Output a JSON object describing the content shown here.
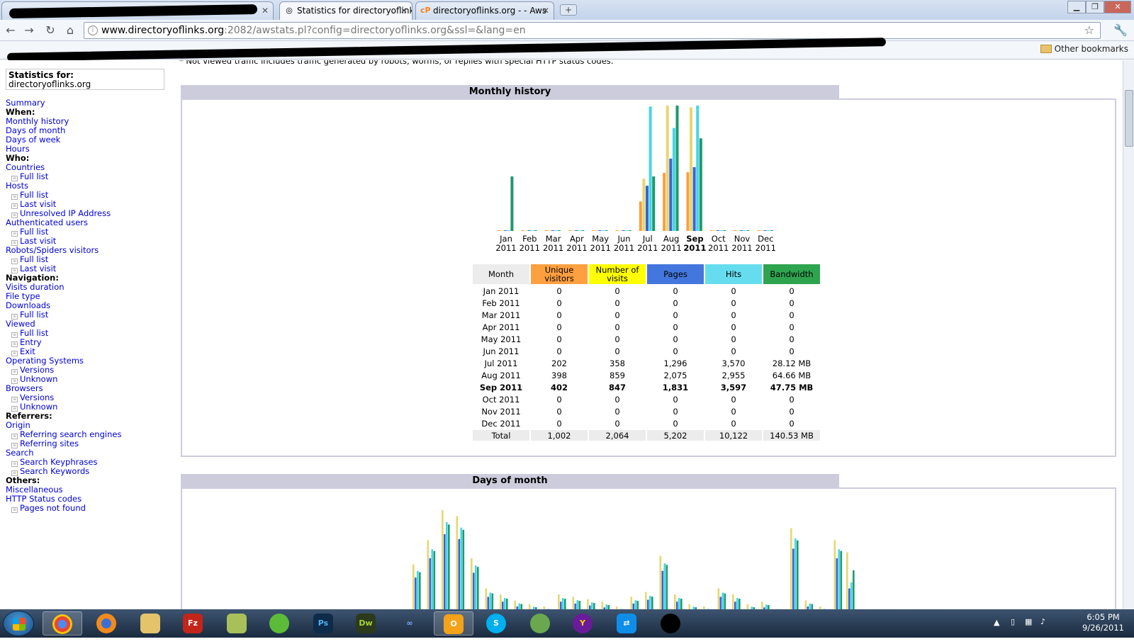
{
  "browser": {
    "tabs": [
      {
        "label": "",
        "redacted": true
      },
      {
        "label": "Statistics for directoryoflink",
        "active": true,
        "icon": "globe-icon"
      },
      {
        "label": "directoryoflinks.org - - Aws",
        "icon": "cpanel-icon"
      }
    ],
    "url_host": "www.directoryoflinks.org",
    "url_rest": ":2082/awstats.pl?config=directoryoflinks.org&ssl=&lang=en",
    "bookmarks_other": "Other bookmarks"
  },
  "page": {
    "note": "* Not viewed traffic includes traffic generated by robots, worms, or replies with special HTTP status codes.",
    "stats_for_label": "Statistics for:",
    "stats_for_site": "directoryoflinks.org",
    "menu": [
      {
        "t": "link",
        "label": "Summary"
      },
      {
        "t": "head",
        "label": "When:"
      },
      {
        "t": "link",
        "label": "Monthly history"
      },
      {
        "t": "link",
        "label": "Days of month"
      },
      {
        "t": "link",
        "label": "Days of week"
      },
      {
        "t": "link",
        "label": "Hours"
      },
      {
        "t": "head",
        "label": "Who:"
      },
      {
        "t": "link",
        "label": "Countries"
      },
      {
        "t": "sub",
        "label": "Full list"
      },
      {
        "t": "link",
        "label": "Hosts"
      },
      {
        "t": "sub",
        "label": "Full list"
      },
      {
        "t": "sub",
        "label": "Last visit"
      },
      {
        "t": "sub",
        "label": "Unresolved IP Address"
      },
      {
        "t": "link",
        "label": "Authenticated users"
      },
      {
        "t": "sub",
        "label": "Full list"
      },
      {
        "t": "sub",
        "label": "Last visit"
      },
      {
        "t": "link",
        "label": "Robots/Spiders visitors"
      },
      {
        "t": "sub",
        "label": "Full list"
      },
      {
        "t": "sub",
        "label": "Last visit"
      },
      {
        "t": "head",
        "label": "Navigation:"
      },
      {
        "t": "link",
        "label": "Visits duration"
      },
      {
        "t": "link",
        "label": "File type"
      },
      {
        "t": "link",
        "label": "Downloads"
      },
      {
        "t": "sub",
        "label": "Full list"
      },
      {
        "t": "link",
        "label": "Viewed"
      },
      {
        "t": "sub",
        "label": "Full list"
      },
      {
        "t": "sub",
        "label": "Entry"
      },
      {
        "t": "sub",
        "label": "Exit"
      },
      {
        "t": "link",
        "label": "Operating Systems"
      },
      {
        "t": "sub",
        "label": "Versions"
      },
      {
        "t": "sub",
        "label": "Unknown"
      },
      {
        "t": "link",
        "label": "Browsers"
      },
      {
        "t": "sub",
        "label": "Versions"
      },
      {
        "t": "sub",
        "label": "Unknown"
      },
      {
        "t": "head",
        "label": "Referrers:"
      },
      {
        "t": "link",
        "label": "Origin"
      },
      {
        "t": "sub",
        "label": "Referring search engines"
      },
      {
        "t": "sub",
        "label": "Referring sites"
      },
      {
        "t": "link",
        "label": "Search"
      },
      {
        "t": "sub",
        "label": "Search Keyphrases"
      },
      {
        "t": "sub",
        "label": "Search Keywords"
      },
      {
        "t": "head",
        "label": "Others:"
      },
      {
        "t": "link",
        "label": "Miscellaneous"
      },
      {
        "t": "link",
        "label": "HTTP Status codes"
      },
      {
        "t": "sub",
        "label": "Pages not found"
      }
    ],
    "monthly_title": "Monthly history",
    "days_title": "Days of month",
    "table": {
      "headers": [
        "Month",
        "Unique visitors",
        "Number of visits",
        "Pages",
        "Hits",
        "Bandwidth"
      ],
      "rows": [
        [
          "Jan 2011",
          "0",
          "0",
          "0",
          "0",
          "0"
        ],
        [
          "Feb 2011",
          "0",
          "0",
          "0",
          "0",
          "0"
        ],
        [
          "Mar 2011",
          "0",
          "0",
          "0",
          "0",
          "0"
        ],
        [
          "Apr 2011",
          "0",
          "0",
          "0",
          "0",
          "0"
        ],
        [
          "May 2011",
          "0",
          "0",
          "0",
          "0",
          "0"
        ],
        [
          "Jun 2011",
          "0",
          "0",
          "0",
          "0",
          "0"
        ],
        [
          "Jul 2011",
          "202",
          "358",
          "1,296",
          "3,570",
          "28.12 MB"
        ],
        [
          "Aug 2011",
          "398",
          "859",
          "2,075",
          "2,955",
          "64.66 MB"
        ],
        [
          "Sep 2011",
          "402",
          "847",
          "1,831",
          "3,597",
          "47.75 MB"
        ],
        [
          "Oct 2011",
          "0",
          "0",
          "0",
          "0",
          "0"
        ],
        [
          "Nov 2011",
          "0",
          "0",
          "0",
          "0",
          "0"
        ],
        [
          "Dec 2011",
          "0",
          "0",
          "0",
          "0",
          "0"
        ]
      ],
      "current_row": 8,
      "total": [
        "Total",
        "1,002",
        "2,064",
        "5,202",
        "10,122",
        "140.53 MB"
      ]
    }
  },
  "chart_data": {
    "type": "bar",
    "categories": [
      "Jan",
      "Feb",
      "Mar",
      "Apr",
      "May",
      "Jun",
      "Jul",
      "Aug",
      "Sep",
      "Oct",
      "Nov",
      "Dec"
    ],
    "category_years": [
      "2011",
      "2011",
      "2011",
      "2011",
      "2011",
      "2011",
      "2011",
      "2011",
      "2011",
      "2011",
      "2011",
      "2011"
    ],
    "highlight_category": "Sep",
    "series": [
      {
        "name": "Unique visitors",
        "color": "#f8a040",
        "values": [
          0,
          0,
          0,
          0,
          0,
          0,
          202,
          398,
          402,
          0,
          0,
          0
        ]
      },
      {
        "name": "Number of visits",
        "color": "#e6d770",
        "values": [
          0,
          0,
          0,
          0,
          0,
          0,
          358,
          859,
          847,
          0,
          0,
          0
        ]
      },
      {
        "name": "Pages",
        "color": "#3a62d6",
        "values": [
          0,
          0,
          0,
          0,
          0,
          0,
          1296,
          2075,
          1831,
          0,
          0,
          0
        ]
      },
      {
        "name": "Hits",
        "color": "#46d6e8",
        "values": [
          0,
          0,
          0,
          0,
          0,
          0,
          3570,
          2955,
          3597,
          0,
          0,
          0
        ]
      },
      {
        "name": "Bandwidth",
        "color": "#1e9a6a",
        "values": [
          28.12,
          0,
          0,
          0,
          0,
          0,
          28.12,
          64.66,
          47.75,
          0,
          0,
          0
        ]
      }
    ],
    "header_colors": {
      "month": "#ececec",
      "unique": "#ffa040",
      "visits": "#ffff00",
      "pages": "#4477dd",
      "hits": "#66ddee",
      "bandwidth": "#2ea44f"
    }
  },
  "taskbar": {
    "apps": [
      "chrome",
      "firefox",
      "explorer",
      "filezilla",
      "app",
      "app",
      "Ps",
      "Dw",
      "app",
      "outlook",
      "skype",
      "messenger",
      "yahoo",
      "teamviewer",
      "redacted"
    ],
    "clock_time": "6:05 PM",
    "clock_date": "9/26/2011"
  }
}
